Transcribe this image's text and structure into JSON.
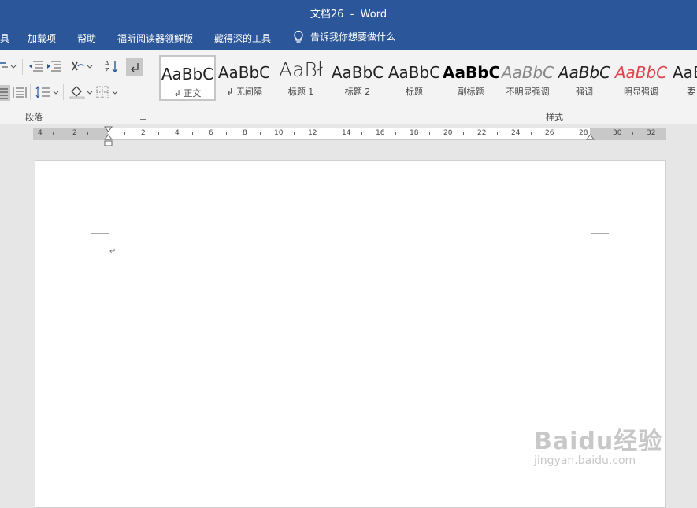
{
  "window": {
    "title": "文档26  -  Word"
  },
  "menu": {
    "items": [
      "具",
      "加载项",
      "帮助",
      "福昕阅读器领鲜版",
      "藏得深的工具"
    ],
    "tell_me": "告诉我你想要做什么"
  },
  "ribbon": {
    "paragraph_group_label": "段落",
    "styles_group_label": "样式",
    "styles": [
      {
        "sample": "AaBbC",
        "name": "↲ 正文"
      },
      {
        "sample": "AaBbC",
        "name": "↲ 无间隔"
      },
      {
        "sample": "AaBł",
        "name": "标题 1"
      },
      {
        "sample": "AaBbC",
        "name": "标题 2"
      },
      {
        "sample": "AaBbC",
        "name": "标题"
      },
      {
        "sample": "AaBbC",
        "name": "副标题"
      },
      {
        "sample": "AaBbC",
        "name": "不明显强调"
      },
      {
        "sample": "AaBbC",
        "name": "强调"
      },
      {
        "sample": "AaBbC",
        "name": "明显强调"
      },
      {
        "sample": "AaB",
        "name": "要"
      }
    ]
  },
  "ruler": {
    "labels": [
      "4",
      "2",
      "2",
      "4",
      "6",
      "8",
      "10",
      "12",
      "14",
      "16",
      "18",
      "20",
      "22",
      "24",
      "26",
      "28",
      "30",
      "32"
    ]
  },
  "document": {
    "paragraph_mark": "↵"
  },
  "watermark": {
    "main": "Baidu经验",
    "sub": "jingyan.baidu.com"
  },
  "colors": {
    "title_bar": "#2b579a",
    "accent_red": "#e0454f"
  }
}
